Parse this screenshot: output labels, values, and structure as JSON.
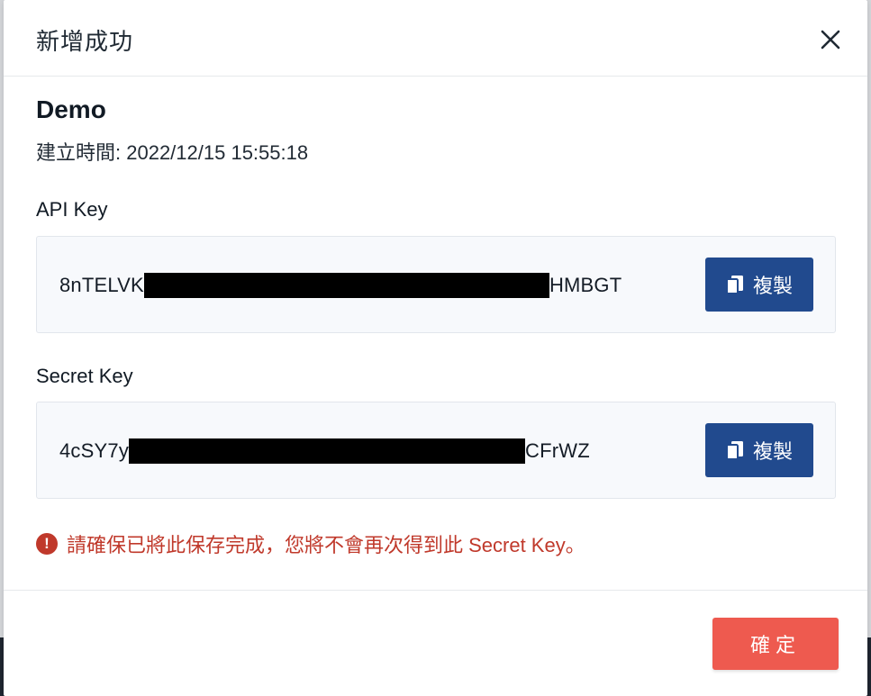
{
  "dialog": {
    "title": "新增成功",
    "close_icon": "close-icon"
  },
  "app": {
    "name": "Demo",
    "created_label": "建立時間: ",
    "created_at": "2022/12/15 15:55:18"
  },
  "api_key": {
    "label": "API Key",
    "prefix": "8nTELVK",
    "suffix": "HMBGT",
    "copy_label": "複製",
    "copy_icon": "copy-icon"
  },
  "secret_key": {
    "label": "Secret Key",
    "prefix": "4cSY7y",
    "suffix": "CFrWZ",
    "copy_label": "複製",
    "copy_icon": "copy-icon"
  },
  "warning": {
    "icon": "exclamation-circle-icon",
    "text": "請確保已將此保存完成，您將不會再次得到此 Secret Key。"
  },
  "footer": {
    "confirm_label": "確定"
  },
  "colors": {
    "primary": "#214a8e",
    "danger": "#ee5a4f",
    "warning_text": "#c0392b"
  }
}
